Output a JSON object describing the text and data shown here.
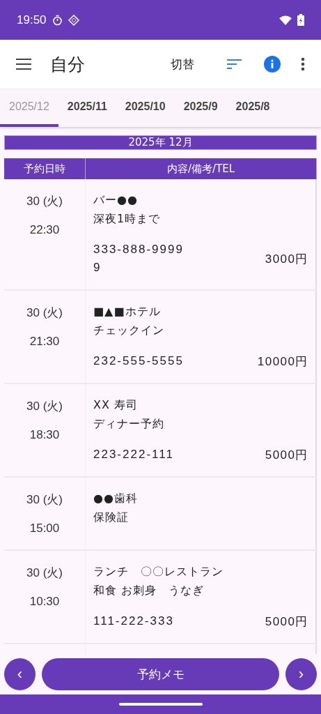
{
  "status_bar": {
    "time": "19:50"
  },
  "app_bar": {
    "title": "自分",
    "switch_label": "切替"
  },
  "tabs": [
    {
      "label": "2025/12",
      "selected": true
    },
    {
      "label": "2025/11",
      "selected": false
    },
    {
      "label": "2025/10",
      "selected": false
    },
    {
      "label": "2025/9",
      "selected": false
    },
    {
      "label": "2025/8",
      "selected": false
    }
  ],
  "month_header": "2025年 12月",
  "table": {
    "columns": [
      "予約日時",
      "内容/備考/TEL"
    ],
    "rows": [
      {
        "day": "30 (火)",
        "time": "22:30",
        "lines": [
          "バー●●",
          "深夜1時まで"
        ],
        "tel": "333-888-99999",
        "price": "3000円"
      },
      {
        "day": "30 (火)",
        "time": "21:30",
        "lines": [
          "■▲■ホテル",
          "チェックイン"
        ],
        "tel": "232-555-5555",
        "price": "10000円"
      },
      {
        "day": "30 (火)",
        "time": "18:30",
        "lines": [
          "XX 寿司",
          "ディナー予約"
        ],
        "tel": "223-222-111",
        "price": "5000円"
      },
      {
        "day": "30 (火)",
        "time": "15:00",
        "lines": [
          "●●歯科",
          "保険証"
        ]
      },
      {
        "day": "30 (火)",
        "time": "10:30",
        "lines": [
          "ランチ　〇〇レストラン",
          "和食 お刺身　うなぎ"
        ],
        "tel": "111-222-333",
        "price": "5000円"
      }
    ]
  },
  "bottom_bar": {
    "prev": "‹",
    "memo": "予約メモ",
    "next": "›"
  }
}
